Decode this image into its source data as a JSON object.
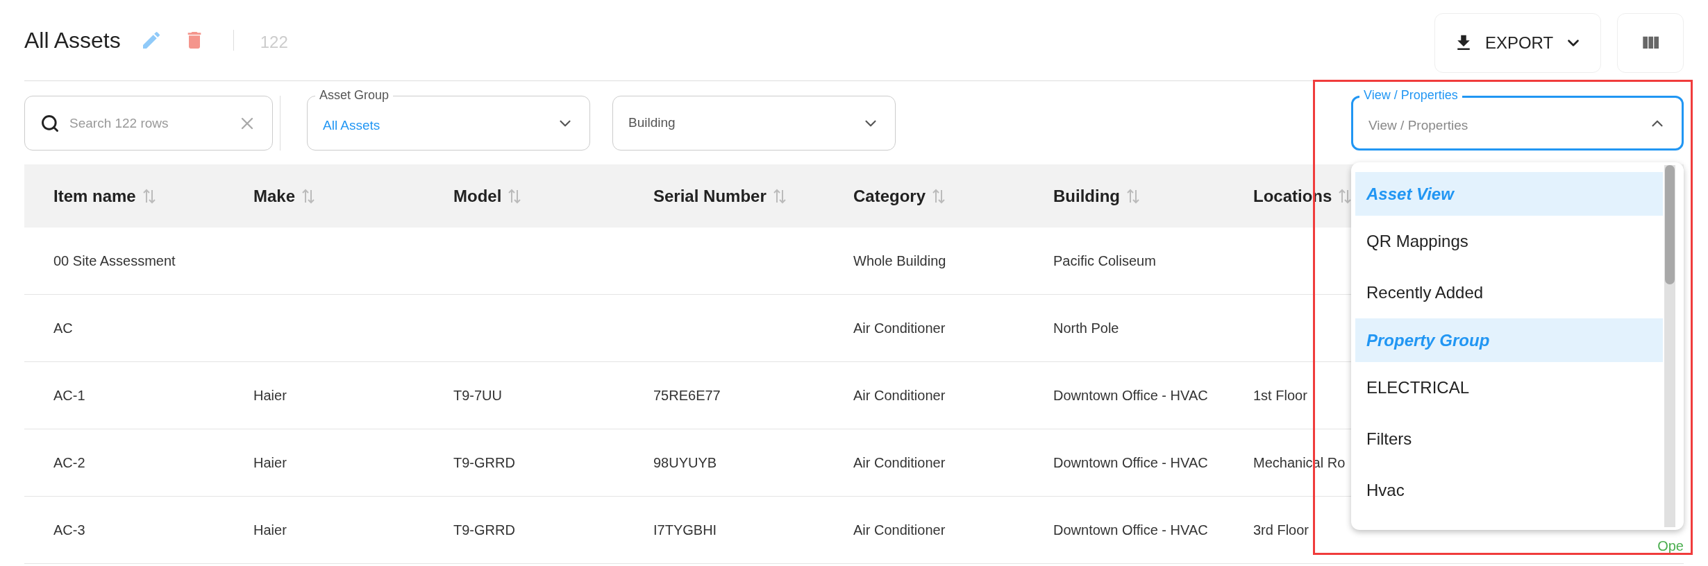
{
  "header": {
    "title": "All Assets",
    "count": "122"
  },
  "export_button": {
    "label": "EXPORT"
  },
  "search": {
    "placeholder": "Search 122 rows"
  },
  "filters": [
    {
      "label": "Asset Group",
      "value": "All Assets"
    },
    {
      "placeholder": "Building"
    }
  ],
  "view_select": {
    "label": "View / Properties",
    "placeholder": "View / Properties",
    "expanded": true
  },
  "menu": {
    "items": [
      {
        "text": "Asset View",
        "kind": "group"
      },
      {
        "text": "QR Mappings",
        "kind": "option"
      },
      {
        "text": "Recently Added",
        "kind": "option"
      },
      {
        "text": "Property Group",
        "kind": "group"
      },
      {
        "text": "ELECTRICAL",
        "kind": "option"
      },
      {
        "text": "Filters",
        "kind": "option"
      },
      {
        "text": "Hvac",
        "kind": "option"
      }
    ]
  },
  "table": {
    "columns": [
      "Item name",
      "Make",
      "Model",
      "Serial Number",
      "Category",
      "Building",
      "Locations"
    ],
    "rows": [
      {
        "cells": [
          "00 Site Assessment",
          "",
          "",
          "",
          "Whole Building",
          "Pacific Coliseum",
          ""
        ]
      },
      {
        "cells": [
          "AC",
          "",
          "",
          "",
          "Air Conditioner",
          "North Pole",
          ""
        ]
      },
      {
        "cells": [
          "AC-1",
          "Haier",
          "T9-7UU",
          "75RE6E77",
          "Air Conditioner",
          "Downtown Office - HVAC",
          "1st Floor"
        ]
      },
      {
        "cells": [
          "AC-2",
          "Haier",
          "T9-GRRD",
          "98UYUYB",
          "Air Conditioner",
          "Downtown Office - HVAC",
          "Mechanical Ro"
        ]
      },
      {
        "cells": [
          "AC-3",
          "Haier",
          "T9-GRRD",
          "I7TYGBHI",
          "Air Conditioner",
          "Downtown Office - HVAC",
          "3rd Floor"
        ],
        "status": "Ope"
      }
    ]
  },
  "highlight_frame": true
}
